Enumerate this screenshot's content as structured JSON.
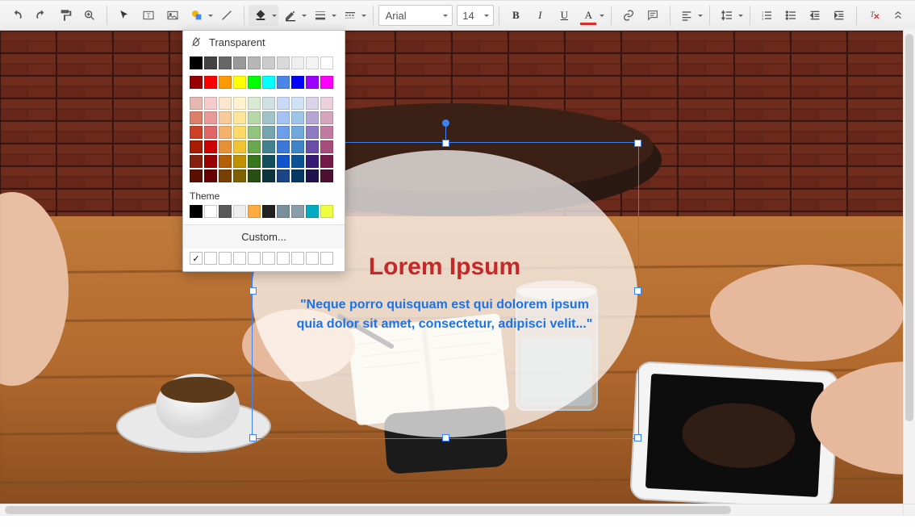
{
  "toolbar": {
    "font": "Arial",
    "size": "14",
    "bold": "B",
    "italic": "I",
    "underline": "U",
    "textcolor": "A"
  },
  "popup": {
    "transparent": "Transparent",
    "theme": "Theme",
    "custom": "Custom...",
    "grays": [
      "#000000",
      "#434343",
      "#666666",
      "#999999",
      "#b7b7b7",
      "#cccccc",
      "#d9d9d9",
      "#efefef",
      "#f3f3f3",
      "#ffffff"
    ],
    "brights": [
      "#980000",
      "#ff0000",
      "#ff9900",
      "#ffff00",
      "#00ff00",
      "#00ffff",
      "#4a86e8",
      "#0000ff",
      "#9900ff",
      "#ff00ff"
    ],
    "shades": [
      [
        "#e6b8af",
        "#f4cccc",
        "#fce5cd",
        "#fff2cc",
        "#d9ead3",
        "#d0e0e3",
        "#c9daf8",
        "#cfe2f3",
        "#d9d2e9",
        "#ead1dc"
      ],
      [
        "#dd7e6b",
        "#ea9999",
        "#f9cb9c",
        "#ffe599",
        "#b6d7a8",
        "#a2c4c9",
        "#a4c2f4",
        "#9fc5e8",
        "#b4a7d6",
        "#d5a6bd"
      ],
      [
        "#cc4125",
        "#e06666",
        "#f6b26b",
        "#ffd966",
        "#93c47d",
        "#76a5af",
        "#6d9eeb",
        "#6fa8dc",
        "#8e7cc3",
        "#c27ba0"
      ],
      [
        "#a61c00",
        "#cc0000",
        "#e69138",
        "#f1c232",
        "#6aa84f",
        "#45818e",
        "#3c78d8",
        "#3d85c6",
        "#674ea7",
        "#a64d79"
      ],
      [
        "#85200c",
        "#990000",
        "#b45f06",
        "#bf9000",
        "#38761d",
        "#134f5c",
        "#1155cc",
        "#0b5394",
        "#351c75",
        "#741b47"
      ],
      [
        "#5b0f00",
        "#660000",
        "#783f04",
        "#7f6000",
        "#274e13",
        "#0c343d",
        "#1c4587",
        "#073763",
        "#20124d",
        "#4c1130"
      ]
    ],
    "theme_colors": [
      "#000000",
      "#ffffff",
      "#595959",
      "#eeeeee",
      "#ffab40",
      "#212121",
      "#78909c",
      "#8b9da8",
      "#00acc1",
      "#eeff41"
    ]
  },
  "slide": {
    "title": "Lorem Ipsum",
    "quote": "\"Neque porro quisquam est qui dolorem ipsum quia dolor sit amet, consectetur, adipisci velit...\""
  }
}
